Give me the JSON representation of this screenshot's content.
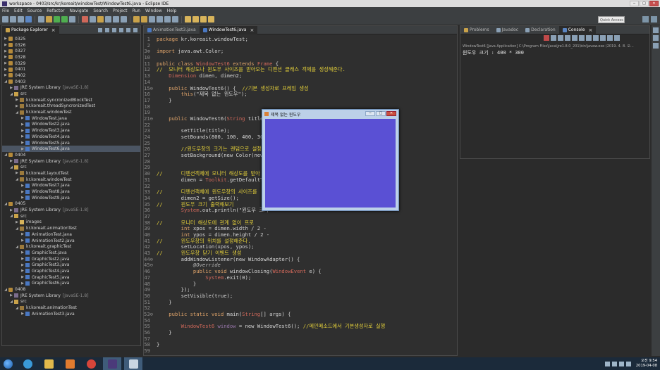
{
  "window": {
    "title": "workspace - 0403/src/kr/koreait/windowTest/WindowTest6.java - Eclipse IDE",
    "min": "─",
    "max": "□",
    "close": "✕"
  },
  "menu": [
    "File",
    "Edit",
    "Source",
    "Refactor",
    "Navigate",
    "Search",
    "Project",
    "Run",
    "Window",
    "Help"
  ],
  "toolbar": {
    "quick_access_placeholder": "Quick Access",
    "icon_colors": [
      "#8aa0b5",
      "#8aa0b5",
      "#8aa0b5",
      "#5b86c4",
      "#8aa0b5",
      "#c9a24a",
      "#4fae4f",
      "#4fae4f",
      "#8aa0b5",
      "#d0685a",
      "#8aa0b5",
      "#c9a24a",
      "#8aa0b5",
      "#8aa0b5",
      "#8aa0b5",
      "#c9a24a",
      "#c9a24a",
      "#8aa0b5",
      "#8aa0b5",
      "#8aa0b5",
      "#8aa0b5",
      "#d8b45b",
      "#d8b45b",
      "#d8b45b",
      "#d8b45b"
    ]
  },
  "package_explorer": {
    "tab": "Package Explorer",
    "tree": [
      {
        "indent": 0,
        "arrow": "▶",
        "icon": "project",
        "label": "0325"
      },
      {
        "indent": 0,
        "arrow": "▶",
        "icon": "project",
        "label": "0326"
      },
      {
        "indent": 0,
        "arrow": "▶",
        "icon": "project",
        "label": "0327"
      },
      {
        "indent": 0,
        "arrow": "▶",
        "icon": "project",
        "label": "0328"
      },
      {
        "indent": 0,
        "arrow": "▶",
        "icon": "project",
        "label": "0329"
      },
      {
        "indent": 0,
        "arrow": "▶",
        "icon": "project",
        "label": "0401"
      },
      {
        "indent": 0,
        "arrow": "▶",
        "icon": "project",
        "label": "0402"
      },
      {
        "indent": 0,
        "arrow": "◢",
        "icon": "project",
        "label": "0403"
      },
      {
        "indent": 1,
        "arrow": "▶",
        "icon": "lib",
        "label": "JRE System Library",
        "extra": "[JavaSE-1.8]"
      },
      {
        "indent": 1,
        "arrow": "◢",
        "icon": "src",
        "label": "src"
      },
      {
        "indent": 2,
        "arrow": "▶",
        "icon": "pkg",
        "label": "kr.koreait.syncronizedBlockTest"
      },
      {
        "indent": 2,
        "arrow": "▶",
        "icon": "pkg",
        "label": "kr.koreait.threadSyncronizedTest"
      },
      {
        "indent": 2,
        "arrow": "◢",
        "icon": "pkg",
        "label": "kr.koreait.windowTest"
      },
      {
        "indent": 3,
        "arrow": "▶",
        "icon": "java",
        "label": "WindowTest.java"
      },
      {
        "indent": 3,
        "arrow": "▶",
        "icon": "java",
        "label": "WindowTest2.java"
      },
      {
        "indent": 3,
        "arrow": "▶",
        "icon": "java",
        "label": "WindowTest3.java"
      },
      {
        "indent": 3,
        "arrow": "▶",
        "icon": "java",
        "label": "WindowTest4.java"
      },
      {
        "indent": 3,
        "arrow": "▶",
        "icon": "java",
        "label": "WindowTest5.java"
      },
      {
        "indent": 3,
        "arrow": "▶",
        "icon": "java",
        "label": "WindowTest6.java",
        "selected": true
      },
      {
        "indent": 0,
        "arrow": "◢",
        "icon": "project",
        "label": "0404"
      },
      {
        "indent": 1,
        "arrow": "▶",
        "icon": "lib",
        "label": "JRE System Library",
        "extra": "[JavaSE-1.8]"
      },
      {
        "indent": 1,
        "arrow": "◢",
        "icon": "src",
        "label": "src"
      },
      {
        "indent": 2,
        "arrow": "▶",
        "icon": "pkg",
        "label": "kr.koreait.layoutTest"
      },
      {
        "indent": 2,
        "arrow": "◢",
        "icon": "pkg",
        "label": "kr.koreait.windowTest"
      },
      {
        "indent": 3,
        "arrow": "▶",
        "icon": "java",
        "label": "WindowTest7.java"
      },
      {
        "indent": 3,
        "arrow": "▶",
        "icon": "java",
        "label": "WindowTest8.java"
      },
      {
        "indent": 3,
        "arrow": "▶",
        "icon": "java",
        "label": "WindowTest9.java"
      },
      {
        "indent": 0,
        "arrow": "◢",
        "icon": "project",
        "label": "0405"
      },
      {
        "indent": 1,
        "arrow": "▶",
        "icon": "lib",
        "label": "JRE System Library",
        "extra": "[JavaSE-1.8]"
      },
      {
        "indent": 1,
        "arrow": "◢",
        "icon": "src",
        "label": "src"
      },
      {
        "indent": 2,
        "arrow": "▶",
        "icon": "folder",
        "label": "images"
      },
      {
        "indent": 2,
        "arrow": "◢",
        "icon": "pkg",
        "label": "kr.koreait.animationTest"
      },
      {
        "indent": 3,
        "arrow": "▶",
        "icon": "java",
        "label": "AnimationTest.java"
      },
      {
        "indent": 3,
        "arrow": "▶",
        "icon": "java",
        "label": "AnimationTest2.java"
      },
      {
        "indent": 2,
        "arrow": "◢",
        "icon": "pkg",
        "label": "kr.koreait.graphicTest"
      },
      {
        "indent": 3,
        "arrow": "▶",
        "icon": "java",
        "label": "GraphicTest.java"
      },
      {
        "indent": 3,
        "arrow": "▶",
        "icon": "java",
        "label": "GraphicTest2.java"
      },
      {
        "indent": 3,
        "arrow": "▶",
        "icon": "java",
        "label": "GraphicTest3.java"
      },
      {
        "indent": 3,
        "arrow": "▶",
        "icon": "java",
        "label": "GraphicTest4.java"
      },
      {
        "indent": 3,
        "arrow": "▶",
        "icon": "java",
        "label": "GraphicTest5.java"
      },
      {
        "indent": 3,
        "arrow": "▶",
        "icon": "java",
        "label": "GraphicTest6.java"
      },
      {
        "indent": 0,
        "arrow": "◢",
        "icon": "project",
        "label": "0408"
      },
      {
        "indent": 1,
        "arrow": "▶",
        "icon": "lib",
        "label": "JRE System Library",
        "extra": "[JavaSE-1.8]"
      },
      {
        "indent": 1,
        "arrow": "◢",
        "icon": "src",
        "label": "src"
      },
      {
        "indent": 2,
        "arrow": "◢",
        "icon": "pkg",
        "label": "kr.koreait.animationTest"
      },
      {
        "indent": 3,
        "arrow": "▶",
        "icon": "java",
        "label": "AnimationTest3.java"
      }
    ]
  },
  "editor": {
    "tabs": [
      {
        "label": "AnimationTest3.java",
        "active": false
      },
      {
        "label": "WindowTest6.java",
        "active": true
      }
    ],
    "lines": [
      {
        "n": "1",
        "segs": [
          [
            "k",
            "package "
          ],
          [
            "ct",
            "kr.koreait.windowTest;"
          ]
        ]
      },
      {
        "n": "2",
        "segs": []
      },
      {
        "n": "3⊕",
        "segs": [
          [
            "k",
            "import "
          ],
          [
            "ct",
            "java.awt.Color;"
          ]
        ]
      },
      {
        "n": "10",
        "segs": []
      },
      {
        "n": "11",
        "segs": [
          [
            "k",
            "public class "
          ],
          [
            "tp",
            "WindowTest6"
          ],
          [
            "k",
            " extends "
          ],
          [
            "tp",
            "Frame"
          ],
          [
            "ct",
            " {"
          ]
        ]
      },
      {
        "n": "12",
        "segs": [
          [
            "cm",
            "//  모니터 해상도나 윈도우 사이즈를 받아오는 디멘션 클래스 객체를 생성해준다."
          ]
        ]
      },
      {
        "n": "13",
        "segs": [
          [
            "tp",
            "    Dimension"
          ],
          [
            "ct",
            " dimen, dimen2;"
          ]
        ]
      },
      {
        "n": "14",
        "segs": []
      },
      {
        "n": "15⊖",
        "segs": [
          [
            "k",
            "    public "
          ],
          [
            "ct",
            "WindowTest6() {  "
          ],
          [
            "cm",
            "//기본 생성자로 프레임 생성"
          ]
        ]
      },
      {
        "n": "16",
        "segs": [
          [
            "k",
            "        this"
          ],
          [
            "ct",
            "("
          ],
          [
            "st",
            "\"제목 없는 윈도우\""
          ],
          [
            "ct",
            ");"
          ]
        ]
      },
      {
        "n": "17",
        "segs": [
          [
            "ct",
            "    }"
          ]
        ]
      },
      {
        "n": "18",
        "segs": []
      },
      {
        "n": "19",
        "segs": []
      },
      {
        "n": "21⊖",
        "segs": [
          [
            "k",
            "    public "
          ],
          [
            "ct",
            "WindowTest6("
          ],
          [
            "tp",
            "String"
          ],
          [
            "ct",
            " title) {  "
          ],
          [
            "cm",
            "//제목을 인수로 받아오는 생성자 생성"
          ]
        ]
      },
      {
        "n": "22",
        "segs": []
      },
      {
        "n": "23",
        "segs": [
          [
            "ct",
            "        setTitle(title);"
          ]
        ]
      },
      {
        "n": "24",
        "segs": [
          [
            "ct",
            "        setBounds(800, 100, 400, 300);      "
          ],
          [
            "cm",
            "//윈도우창 크기와 위치 조절"
          ]
        ]
      },
      {
        "n": "25",
        "segs": []
      },
      {
        "n": "26",
        "segs": [
          [
            "cm",
            "        //윈도우창의 크기는 랜덤으로 설정"
          ]
        ]
      },
      {
        "n": "27",
        "segs": [
          [
            "ct",
            "        setBackground(new Color(new Random"
          ]
        ]
      },
      {
        "n": "28",
        "segs": []
      },
      {
        "n": "29",
        "segs": []
      },
      {
        "n": "30",
        "segs": [
          [
            "cm",
            "//      디멘션객체에 모니터 해상도를 받아"
          ]
        ]
      },
      {
        "n": "31",
        "segs": [
          [
            "ct",
            "        dimen = "
          ],
          [
            "tp",
            "Toolkit"
          ],
          [
            "ct",
            ".getDefaultToolkit"
          ]
        ]
      },
      {
        "n": "32",
        "segs": []
      },
      {
        "n": "33",
        "segs": [
          [
            "cm",
            "//      디멘션객체에 윈도우창의 사이즈를"
          ]
        ]
      },
      {
        "n": "34",
        "segs": [
          [
            "ct",
            "        dimen2 = getSize();"
          ]
        ]
      },
      {
        "n": "35",
        "segs": [
          [
            "cm",
            "//      윈도우 크기 출력해보기"
          ]
        ]
      },
      {
        "n": "36",
        "segs": [
          [
            "tp",
            "        System"
          ],
          [
            "ct",
            ".out.println("
          ],
          [
            "st",
            "\"윈도우 크기"
          ]
        ]
      },
      {
        "n": "37",
        "segs": []
      },
      {
        "n": "38",
        "segs": [
          [
            "cm",
            "//      모니터 해상도에 관계 없이 프로"
          ]
        ]
      },
      {
        "n": "39",
        "segs": [
          [
            "k",
            "        int "
          ],
          [
            "ct",
            "xpos = dimen.width / 2 -"
          ]
        ]
      },
      {
        "n": "40",
        "segs": [
          [
            "k",
            "        int "
          ],
          [
            "ct",
            "ypos = dimen.height / 2 -"
          ]
        ]
      },
      {
        "n": "41",
        "segs": [
          [
            "cm",
            "//      윈도우창의 위치를 설정해준다."
          ]
        ]
      },
      {
        "n": "42",
        "segs": [
          [
            "ct",
            "        setLocation(xpos, ypos);"
          ]
        ]
      },
      {
        "n": "43",
        "segs": [
          [
            "cm",
            "//      윈도우창 닫기 이벤트 생성"
          ]
        ]
      },
      {
        "n": "44⊖",
        "segs": [
          [
            "ct",
            "        addWindowListener(new WindowAdapter() {"
          ]
        ]
      },
      {
        "n": "45⊖",
        "segs": [
          [
            "an",
            "            @Override"
          ]
        ]
      },
      {
        "n": "46",
        "segs": [
          [
            "k",
            "            public void "
          ],
          [
            "ct",
            "windowClosing("
          ],
          [
            "tp",
            "WindowEvent"
          ],
          [
            "ct",
            " e) {"
          ]
        ]
      },
      {
        "n": "47",
        "segs": [
          [
            "tp",
            "                System"
          ],
          [
            "ct",
            ".exit(0);"
          ]
        ]
      },
      {
        "n": "48",
        "segs": [
          [
            "ct",
            "            }"
          ]
        ]
      },
      {
        "n": "49",
        "segs": [
          [
            "ct",
            "        });"
          ]
        ]
      },
      {
        "n": "50",
        "segs": [
          [
            "ct",
            "        setVisible(true);"
          ]
        ]
      },
      {
        "n": "51",
        "segs": [
          [
            "ct",
            "    }"
          ]
        ]
      },
      {
        "n": "52",
        "segs": []
      },
      {
        "n": "53⊖",
        "segs": [
          [
            "k",
            "    public static void "
          ],
          [
            "ct",
            "main("
          ],
          [
            "tp",
            "String"
          ],
          [
            "ct",
            "[] args) {"
          ]
        ]
      },
      {
        "n": "54",
        "segs": []
      },
      {
        "n": "55",
        "segs": [
          [
            "tp",
            "        WindowTest6"
          ],
          [
            "fld",
            " window"
          ],
          [
            "ct",
            " = new WindowTest6(); "
          ],
          [
            "cm",
            "//메인메소드에서 기본생성자로 실행"
          ]
        ]
      },
      {
        "n": "56",
        "segs": [
          [
            "ct",
            "    }"
          ]
        ]
      },
      {
        "n": "57",
        "segs": []
      },
      {
        "n": "58",
        "segs": [
          [
            "ct",
            "}"
          ]
        ]
      },
      {
        "n": "59",
        "segs": []
      },
      {
        "n": "60",
        "segs": []
      },
      {
        "n": "61",
        "segs": []
      },
      {
        "n": "62",
        "segs": []
      },
      {
        "n": "63",
        "segs": []
      }
    ]
  },
  "console": {
    "tabs": [
      {
        "label": "Problems",
        "active": false,
        "color": "#c9a24a"
      },
      {
        "label": "Javadoc",
        "active": false,
        "color": "#8aa0b5"
      },
      {
        "label": "Declaration",
        "active": false,
        "color": "#8aa0b5"
      },
      {
        "label": "Console",
        "active": true,
        "color": "#5b86c4"
      }
    ],
    "description": "WindowTest6 [Java Application] C:\\Program Files\\Java\\jre1.8.0_201\\bin\\javaw.exe (2019. 4. 8. 오...",
    "output": "윈도우 크기 : 400 * 300"
  },
  "floating_window": {
    "title": "제목 없는 윈도우",
    "min": "─",
    "max": "□",
    "close": "✕",
    "content_color": "#5a50d4"
  },
  "taskbar": {
    "apps": [
      {
        "name": "ie",
        "color": "#3a9ad9",
        "active": false
      },
      {
        "name": "explorer",
        "color": "#e1b94b",
        "active": false
      },
      {
        "name": "media",
        "color": "#e07b2f",
        "active": false
      },
      {
        "name": "chrome",
        "color": "#d6453a",
        "active": false
      },
      {
        "name": "eclipse",
        "color": "#4b3a7a",
        "active": true
      },
      {
        "name": "java",
        "color": "#c9d6e3",
        "active": true
      }
    ],
    "time": "오전 9:54",
    "date": "2019-04-08"
  }
}
